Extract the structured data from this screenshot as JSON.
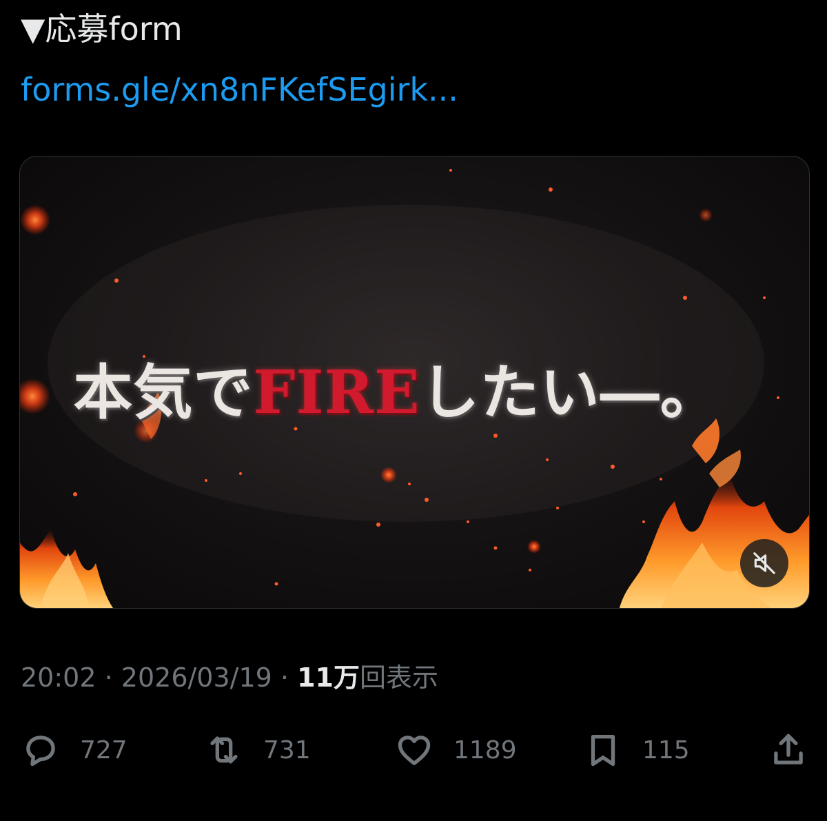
{
  "tweet": {
    "text_line": "▼応募form",
    "link": "forms.gle/xn8nFKefSEgirk..."
  },
  "media": {
    "headline_part1": "本気で",
    "headline_highlight": "FIRE",
    "headline_part2": "したい―。",
    "mute_icon": "speaker-muted-icon",
    "colors": {
      "headline_white": "#ece6e2",
      "headline_red": "#d21a2e"
    }
  },
  "meta": {
    "time": "20:02",
    "separator": "·",
    "date": "2026/03/19",
    "views_count": "11万",
    "views_label": "回表示"
  },
  "actions": {
    "reply": {
      "icon": "reply-bubble-icon",
      "count": "727"
    },
    "retweet": {
      "icon": "retweet-icon",
      "count": "731"
    },
    "like": {
      "icon": "heart-icon",
      "count": "1189"
    },
    "bookmark": {
      "icon": "bookmark-icon",
      "count": "115"
    },
    "share": {
      "icon": "share-icon"
    }
  },
  "colors": {
    "background": "#000000",
    "text_primary": "#e7e9ea",
    "text_secondary": "#71767b",
    "link": "#1d9bf0"
  }
}
